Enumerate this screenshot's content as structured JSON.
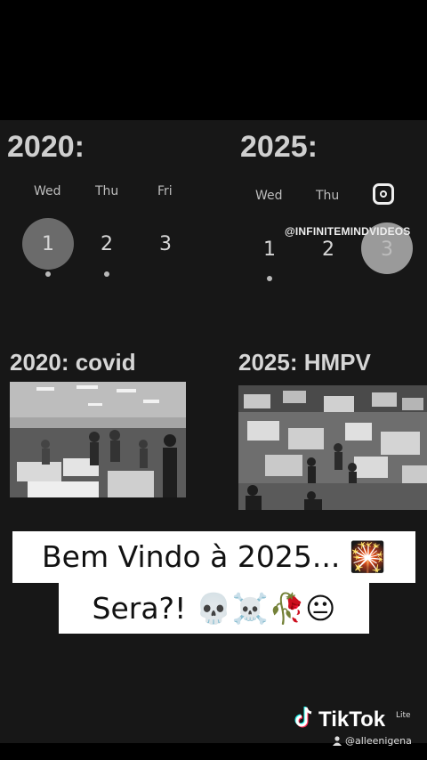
{
  "left": {
    "title": "2020:",
    "days": [
      "Wed",
      "Thu",
      "Fri"
    ],
    "dates": [
      "1",
      "2",
      "3"
    ],
    "subtitle": "2020: covid"
  },
  "right": {
    "title": "2025:",
    "days": [
      "Wed",
      "Thu"
    ],
    "dates": [
      "1",
      "2",
      "3"
    ],
    "subtitle": "2025: HMPV"
  },
  "watermark": {
    "handle": "@INFINITEMINDVIDEOS",
    "icon": "instagram-icon"
  },
  "caption": {
    "line1": "Bem Vindo à 2025... 🎇",
    "line2": "Sera?! 💀☠️🥀😐"
  },
  "tiktok": {
    "brand": "TikTok",
    "lite": "Lite",
    "user": "@alleenigena"
  },
  "colors": {
    "background": "#000000",
    "panel": "#171717",
    "caption_bg": "#ffffff"
  }
}
